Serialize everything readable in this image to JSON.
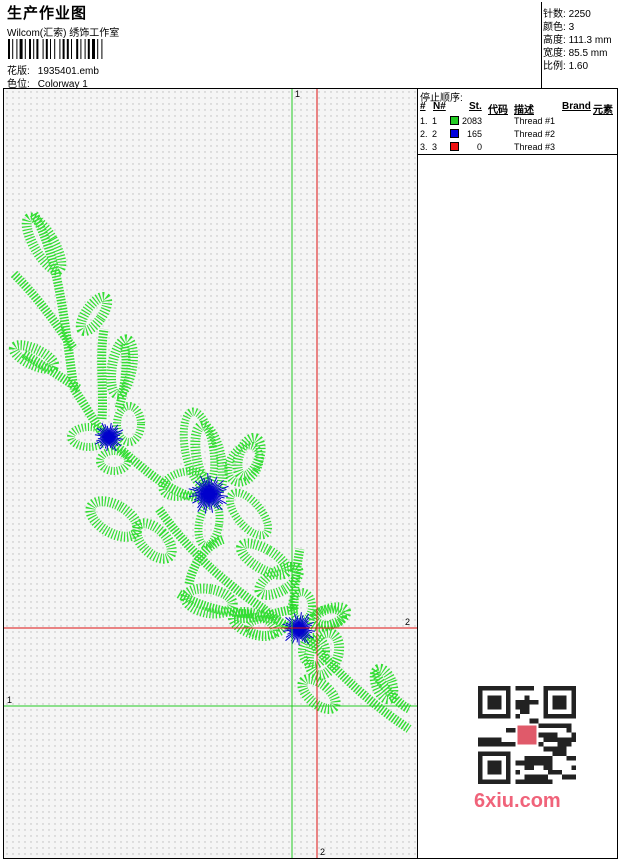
{
  "header": {
    "title": "生产作业图",
    "company": "Wilcom(汇索) 绣饰工作室",
    "design_label": "花版:",
    "design_value": "1935401.emb",
    "colorway_label": "色位:",
    "colorway_value": "Colorway 1"
  },
  "stats": {
    "stitches_label": "针数:",
    "stitches_value": "2250",
    "colors_label": "颜色:",
    "colors_value": "3",
    "height_label": "高度:",
    "height_value": "111.3 mm",
    "width_label": "宽度:",
    "width_value": "85.5 mm",
    "scale_label": "比例:",
    "scale_value": "1.60"
  },
  "stop_sequence": {
    "title": "停止顺序:",
    "headers": [
      "#",
      "N#",
      "St.",
      "代码",
      "描述",
      "Brand",
      "元素"
    ],
    "rows": [
      {
        "idx": "1.",
        "n": "1",
        "color": "#22cc22",
        "stitches": "2083",
        "desc": "Thread #1"
      },
      {
        "idx": "2.",
        "n": "2",
        "color": "#0000dd",
        "stitches": "165",
        "desc": "Thread #2"
      },
      {
        "idx": "3.",
        "n": "3",
        "color": "#ee1111",
        "stitches": "0",
        "desc": "Thread #3"
      }
    ]
  },
  "axis_labels": {
    "top_green": "1",
    "bottom_red": "2",
    "left_green": "1",
    "right_red": "2"
  },
  "watermark": "6xiu.com",
  "colors": {
    "thread1": "#33dd33",
    "thread2": "#0000cc",
    "guide_green": "#22cc22",
    "guide_red": "#dd1111"
  }
}
